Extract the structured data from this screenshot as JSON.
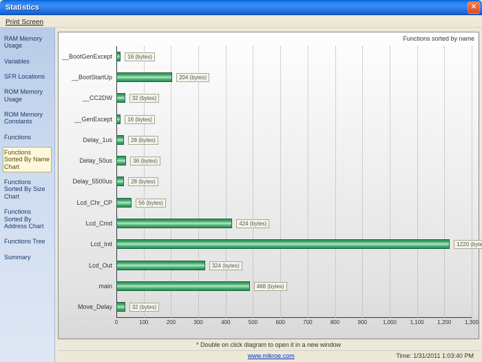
{
  "window": {
    "title": "Statistics"
  },
  "menu": {
    "print_screen": "Print Screen"
  },
  "sidebar": {
    "items": [
      {
        "label": "RAM Memory Usage",
        "id": "ram-memory-usage"
      },
      {
        "label": "Variables",
        "id": "variables"
      },
      {
        "label": "SFR Locations",
        "id": "sfr-locations"
      },
      {
        "label": "ROM Memory Usage",
        "id": "rom-memory-usage"
      },
      {
        "label": "ROM Memory Constants",
        "id": "rom-memory-constants"
      },
      {
        "label": "Functions",
        "id": "functions"
      },
      {
        "label": "Functions Sorted By Name Chart",
        "id": "fn-sorted-name",
        "active": true
      },
      {
        "label": "Functions Sorted By Size Chart",
        "id": "fn-sorted-size"
      },
      {
        "label": "Functions Sorted By Address Chart",
        "id": "fn-sorted-addr"
      },
      {
        "label": "Functions Tree",
        "id": "fn-tree"
      },
      {
        "label": "Summary",
        "id": "summary"
      }
    ]
  },
  "chart_data": {
    "type": "bar",
    "orientation": "horizontal",
    "title": "Functions sorted by name",
    "xlabel": "",
    "ylabel": "",
    "xlim": [
      0,
      1300
    ],
    "ticks": [
      0,
      100,
      200,
      300,
      400,
      500,
      600,
      700,
      800,
      900,
      1000,
      1100,
      1200,
      1300
    ],
    "unit": "bytes",
    "categories": [
      "__BootGenExcept",
      "__BootStartUp",
      "__CC2DW",
      "__GenExcept",
      "Delay_1us",
      "Delay_50us",
      "Delay_5500us",
      "Lcd_Chr_CP",
      "Lcd_Cmd",
      "Lcd_Init",
      "Lcd_Out",
      "main",
      "Move_Delay"
    ],
    "values": [
      16,
      204,
      32,
      16,
      28,
      36,
      28,
      56,
      424,
      1220,
      324,
      488,
      32
    ]
  },
  "hint": "* Double on click diagram to open it in a new window",
  "footer": {
    "link_label": "www.mikroe.com",
    "time_label": "Time: 1/31/2011 1:03:40 PM"
  },
  "colors": {
    "bar_fill": "#3ea063",
    "accent_xp": "#2a7de1",
    "sidebar_bg": "#cddbf0"
  }
}
